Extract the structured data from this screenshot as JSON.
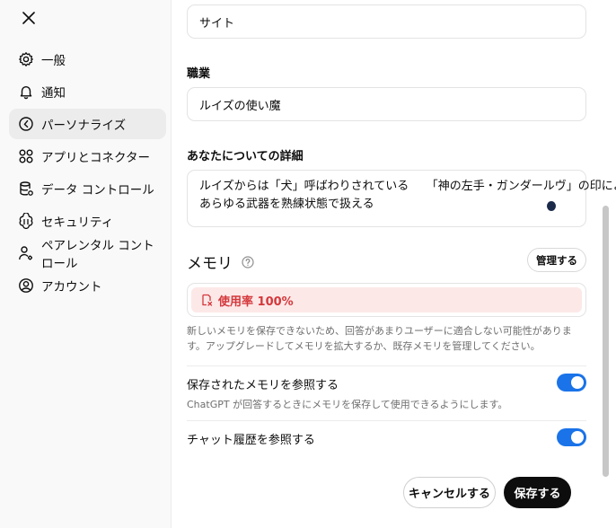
{
  "sidebar": {
    "items": [
      {
        "label": "一般",
        "icon": "gear-icon"
      },
      {
        "label": "通知",
        "icon": "bell-icon"
      },
      {
        "label": "パーソナライズ",
        "icon": "personalize-icon"
      },
      {
        "label": "アプリとコネクター",
        "icon": "apps-icon"
      },
      {
        "label": "データ コントロール",
        "icon": "database-icon"
      },
      {
        "label": "セキュリティ",
        "icon": "shield-icon"
      },
      {
        "label": "ペアレンタル コントロール",
        "icon": "parental-icon"
      },
      {
        "label": "アカウント",
        "icon": "user-circle-icon"
      }
    ],
    "active_index": 2
  },
  "form": {
    "nickname_value": "サイト",
    "occupation_label": "職業",
    "occupation_value": "ルイズの使い魔",
    "details_label": "あなたについての詳細",
    "details_line1": "ルイズからは「犬」呼ばわりされている　　「神の左手・ガンダールヴ」の印により",
    "details_line2": "あらゆる武器を熟練状態で扱える"
  },
  "memory": {
    "title": "メモリ",
    "manage_label": "管理する",
    "usage_label": "使用率 100%",
    "description": "新しいメモリを保存できないため、回答があまりユーザーに適合しない可能性があります。アップグレードしてメモリを拡大するか、既存メモリを管理してください。",
    "saved_title": "保存されたメモリを参照する",
    "saved_desc": "ChatGPT が回答するときにメモリを保存して使用できるようにします。",
    "saved_enabled": true,
    "history_title": "チャット履歴を参照する",
    "history_enabled": true
  },
  "footer": {
    "cancel_label": "キャンセルする",
    "save_label": "保存する"
  },
  "colors": {
    "toggle_on": "#1a73e8",
    "usage_bg": "#fde8e8",
    "usage_text": "#d4383b",
    "active_nav": "#ececec"
  }
}
